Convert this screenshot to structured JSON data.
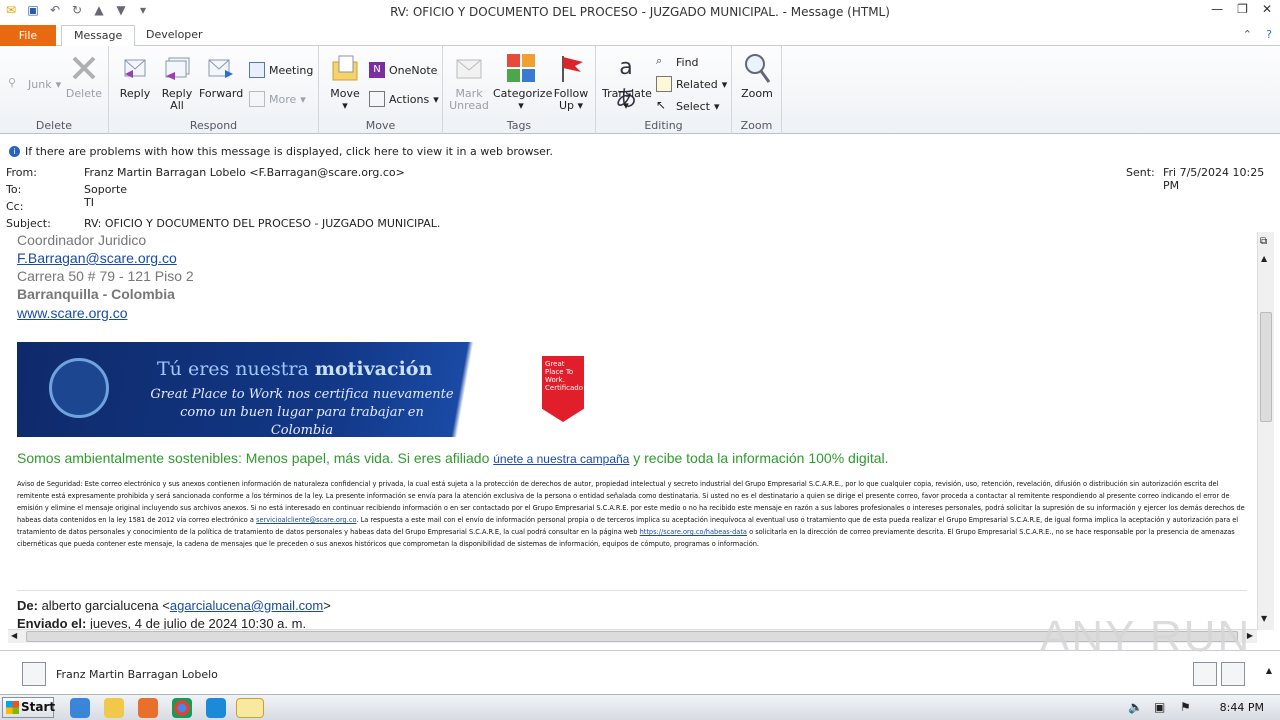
{
  "window": {
    "title": "RV: OFICIO Y DOCUMENTO DEL PROCESO - JUZGADO MUNICIPAL. - Message (HTML)"
  },
  "tabs": {
    "file": "File",
    "message": "Message",
    "developer": "Developer"
  },
  "ribbon": {
    "delete_group": {
      "label": "Delete",
      "junk": "Junk",
      "delete": "Delete"
    },
    "respond_group": {
      "label": "Respond",
      "reply": "Reply",
      "reply_all_1": "Reply",
      "reply_all_2": "All",
      "forward": "Forward",
      "meeting": "Meeting",
      "more": "More"
    },
    "move_group": {
      "label": "Move",
      "move": "Move",
      "onenote": "OneNote",
      "actions": "Actions"
    },
    "tags_group": {
      "label": "Tags",
      "mark_unread_1": "Mark",
      "mark_unread_2": "Unread",
      "categorize": "Categorize",
      "follow_up_1": "Follow",
      "follow_up_2": "Up"
    },
    "editing_group": {
      "label": "Editing",
      "translate": "Translate",
      "find": "Find",
      "related": "Related",
      "select": "Select"
    },
    "zoom_group": {
      "label": "Zoom",
      "zoom": "Zoom"
    }
  },
  "infobar": {
    "text": "If there are problems with how this message is displayed, click here to view it in a web browser."
  },
  "header": {
    "from_label": "From:",
    "from_value": "Franz Martin Barragan Lobelo <F.Barragan@scare.org.co>",
    "to_label": "To:",
    "to_value": "Soporte TI",
    "cc_label": "Cc:",
    "subject_label": "Subject:",
    "subject_value": "RV: OFICIO Y DOCUMENTO DEL PROCESO - JUZGADO MUNICIPAL.",
    "sent_label": "Sent:",
    "sent_value": "Fri 7/5/2024 10:25 PM"
  },
  "body": {
    "sig_title": "Coordinador Juridico",
    "sig_email": "F.Barragan@scare.org.co",
    "sig_address": "Carrera 50 # 79 - 121 Piso 2",
    "sig_city": "Barranquilla - Colombia",
    "sig_web": "www.scare.org.co",
    "banner_line1_a": "Tú eres nuestra ",
    "banner_line1_b": "motivación",
    "banner_line2": "Great Place to Work nos certifica nuevamente",
    "banner_line3": "como un buen lugar para trabajar en Colombia",
    "badge_text": "Great Place To Work. Certificado",
    "green_a": "Somos ambientalmente sostenibles: Menos papel, más vida. Si eres afiliado ",
    "green_link": "únete a nuestra campaña",
    "green_b": " y recibe toda la información 100% digital.",
    "disclaimer_a": "Aviso de Seguridad: Este correo electrónico y sus anexos contienen información de naturaleza confidencial y privada, la cual está sujeta a la protección de derechos de autor, propiedad intelectual y secreto industrial del Grupo Empresarial S.C.A.R.E., por lo que cualquier copia, revisión, uso, retención, revelación, difusión o distribución sin autorización escrita del remitente está expresamente prohibida y será sancionada conforme a los términos de la ley. La presente información se envía para la atención exclusiva de la persona o entidad señalada como destinataria. Si usted no es el destinatario a quien se dirige el presente correo, favor proceda a contactar al remitente respondiendo al presente correo indicando el error de emisión y elimine el mensaje original incluyendo sus archivos anexos. Si no está interesado en continuar recibiendo información o en ser contactado por el Grupo Empresarial S.C.A.R.E. por este medio o no ha recibido este mensaje en razón a sus labores profesionales o intereses personales, podrá solicitar la supresión de su información y ejercer los demás derechos de habeas data contenidos en la ley 1581 de 2012 vía correo electrónico a ",
    "disclaimer_link1": "servicioalcliente@scare.org.co",
    "disclaimer_b": ". La respuesta a este mail con el envío de información personal propia o de terceros implica su aceptación inequívoca al eventual uso o tratamiento que de esta pueda realizar el Grupo Empresarial S.C.A.R.E, de igual forma implica la aceptación y autorización para el tratamiento de datos personales y conocimiento de la política de tratamiento de datos personales y habeas data del Grupo Empresarial S.C.A.R.E, la cual podrá consultar en la página web ",
    "disclaimer_link2": "https://scare.org.co/habeas-data",
    "disclaimer_c": " o solicitarla en la dirección de correo previamente descrita. El Grupo Empresarial S.C.A.R.E., no se hace responsable por la presencia de amenazas cibernéticas que pueda contener este mensaje, la cadena de mensajes que le preceden o sus anexos históricos que comprometan la disponibilidad de sistemas de información, equipos de cómputo, programas o información.",
    "fw_de_label": "De:",
    "fw_de_name": " alberto garcialucena <",
    "fw_de_email": "agarcialucena@gmail.com",
    "fw_de_close": ">",
    "fw_sent_label": "Enviado el:",
    "fw_sent_value": " jueves, 4 de julio de 2024 10:30 a. m."
  },
  "people_pane": {
    "name": "Franz Martin Barragan Lobelo"
  },
  "taskbar": {
    "start": "Start",
    "clock": "8:44 PM"
  },
  "watermark": "ANY RUN"
}
